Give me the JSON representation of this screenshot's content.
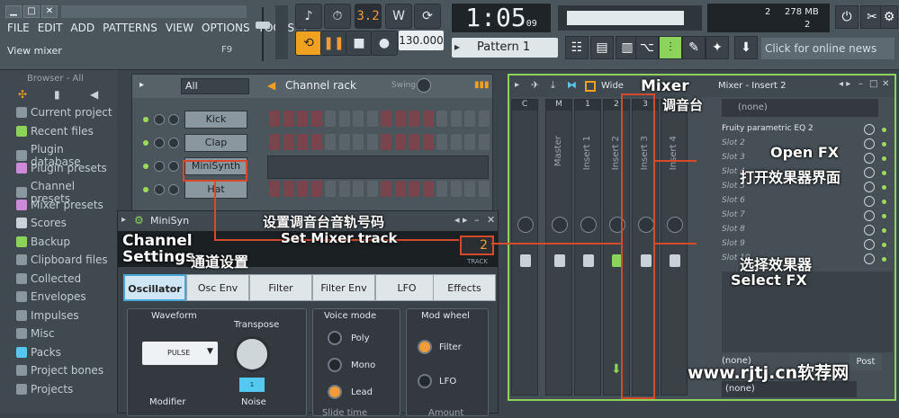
{
  "menu": {
    "items": [
      "FILE",
      "EDIT",
      "ADD",
      "PATTERNS",
      "VIEW",
      "OPTIONS",
      "TOOLS",
      "?"
    ]
  },
  "hint": {
    "text": "View mixer",
    "shortcut": "F9"
  },
  "transport": {
    "tempo": "130.000",
    "time": "1:05",
    "time_frac": "09",
    "step": "3.2"
  },
  "pattern": {
    "label": "Pattern 1"
  },
  "cpu": {
    "mem": "278 MB",
    "cpu_val": "2",
    "poly": "2"
  },
  "news": {
    "text": "Click for online news"
  },
  "browser": {
    "header": "Browser - All",
    "items": [
      "Current project",
      "Recent files",
      "Plugin database",
      "Plugin presets",
      "Channel presets",
      "Mixer presets",
      "Scores",
      "Backup",
      "Clipboard files",
      "Collected",
      "Envelopes",
      "Impulses",
      "Misc",
      "Packs",
      "Project bones",
      "Projects"
    ]
  },
  "rack": {
    "filter": "All",
    "title": "Channel rack",
    "swing": "Swing",
    "channels": [
      "Kick",
      "Clap",
      "MiniSynth",
      "Hat"
    ]
  },
  "chset": {
    "title": "MiniSyn",
    "tabs": [
      "Oscillator",
      "Osc Env",
      "Filter",
      "Filter Env",
      "LFO",
      "Effects"
    ],
    "track_num": "2",
    "track_lbl": "TRACK",
    "waveform": "Waveform",
    "wave_value": "PULSE",
    "transpose": "Transpose",
    "transpose_val": "1",
    "modifier": "Modifier",
    "noise": "Noise",
    "voice_mode": "Voice mode",
    "voice": [
      "Poly",
      "Mono",
      "Lead"
    ],
    "mod_wheel": "Mod wheel",
    "mod": [
      "Filter",
      "LFO"
    ],
    "glide": "Slide time",
    "amount": "Amount"
  },
  "mixer": {
    "title": "Mixer - Insert 2",
    "wide": "Wide",
    "strip_labels": [
      "Master",
      "Insert 1",
      "Insert 2",
      "Insert 3",
      "Insert 4"
    ],
    "strip_nums": [
      "C",
      "M",
      "1",
      "2",
      "3",
      "4"
    ],
    "none": "(none)",
    "slots": [
      "Fruity parametric EQ 2",
      "Slot 2",
      "Slot 3",
      "Slot 4",
      "Slot 5",
      "Slot 6",
      "Slot 7",
      "Slot 8",
      "Slot 9",
      "Slot 10"
    ],
    "post": "Post",
    "none_bottom1": "(none)",
    "none_bottom2": "(none)"
  },
  "annotations": {
    "mixer_en": "Mixer",
    "mixer_cn": "调音台",
    "openfx_en": "Open FX",
    "openfx_cn": "打开效果器界面",
    "setmixer_cn": "设置调音台音轨号码",
    "setmixer_en": "Set Mixer track",
    "channel_en1": "Channel",
    "channel_en2": "Settings",
    "channel_cn": "通道设置",
    "selectfx_cn": "选择效果器",
    "selectfx_en": "Select FX",
    "watermark": "www.rjtj.cn软荐网"
  },
  "colors": {
    "accent_green": "#8bd35a",
    "highlight_red": "#d44a2b",
    "lcd_orange": "#f29b3a"
  }
}
